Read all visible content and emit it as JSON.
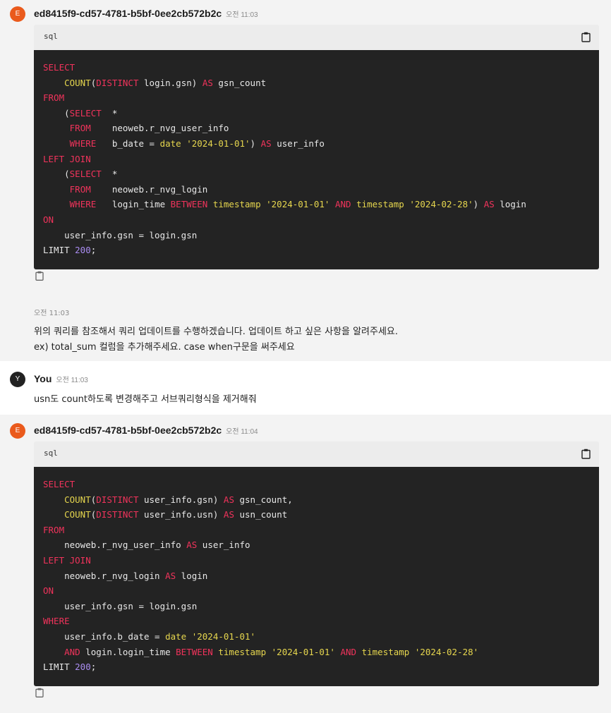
{
  "messages": [
    {
      "avatar_letter": "E",
      "sender": "ed8415f9-cd57-4781-b5bf-0ee2cb572b2c",
      "time": "오전 11:03",
      "code": {
        "language": "sql",
        "lines": [
          [
            {
              "t": "SELECT",
              "c": "kw"
            }
          ],
          [
            {
              "t": "    ",
              "c": "plain"
            },
            {
              "t": "COUNT",
              "c": "fn"
            },
            {
              "t": "(",
              "c": "plain"
            },
            {
              "t": "DISTINCT",
              "c": "kw"
            },
            {
              "t": " login.gsn) ",
              "c": "plain"
            },
            {
              "t": "AS",
              "c": "kw"
            },
            {
              "t": " gsn_count",
              "c": "plain"
            }
          ],
          [
            {
              "t": "FROM",
              "c": "kw"
            }
          ],
          [
            {
              "t": "    (",
              "c": "plain"
            },
            {
              "t": "SELECT",
              "c": "kw"
            },
            {
              "t": "  *",
              "c": "plain"
            }
          ],
          [
            {
              "t": "     ",
              "c": "plain"
            },
            {
              "t": "FROM",
              "c": "kw"
            },
            {
              "t": "    neoweb.r_nvg_user_info",
              "c": "plain"
            }
          ],
          [
            {
              "t": "     ",
              "c": "plain"
            },
            {
              "t": "WHERE",
              "c": "kw"
            },
            {
              "t": "   b_date = ",
              "c": "plain"
            },
            {
              "t": "date",
              "c": "fn"
            },
            {
              "t": " ",
              "c": "plain"
            },
            {
              "t": "'2024-01-01'",
              "c": "str"
            },
            {
              "t": ") ",
              "c": "plain"
            },
            {
              "t": "AS",
              "c": "kw"
            },
            {
              "t": " user_info",
              "c": "plain"
            }
          ],
          [
            {
              "t": "LEFT JOIN",
              "c": "kw"
            }
          ],
          [
            {
              "t": "    (",
              "c": "plain"
            },
            {
              "t": "SELECT",
              "c": "kw"
            },
            {
              "t": "  *",
              "c": "plain"
            }
          ],
          [
            {
              "t": "     ",
              "c": "plain"
            },
            {
              "t": "FROM",
              "c": "kw"
            },
            {
              "t": "    neoweb.r_nvg_login",
              "c": "plain"
            }
          ],
          [
            {
              "t": "     ",
              "c": "plain"
            },
            {
              "t": "WHERE",
              "c": "kw"
            },
            {
              "t": "   login_time ",
              "c": "plain"
            },
            {
              "t": "BETWEEN",
              "c": "kw"
            },
            {
              "t": " ",
              "c": "plain"
            },
            {
              "t": "timestamp",
              "c": "fn"
            },
            {
              "t": " ",
              "c": "plain"
            },
            {
              "t": "'2024-01-01'",
              "c": "str"
            },
            {
              "t": " ",
              "c": "plain"
            },
            {
              "t": "AND",
              "c": "kw"
            },
            {
              "t": " ",
              "c": "plain"
            },
            {
              "t": "timestamp",
              "c": "fn"
            },
            {
              "t": " ",
              "c": "plain"
            },
            {
              "t": "'2024-02-28'",
              "c": "str"
            },
            {
              "t": ") ",
              "c": "plain"
            },
            {
              "t": "AS",
              "c": "kw"
            },
            {
              "t": " login",
              "c": "plain"
            }
          ],
          [
            {
              "t": "ON",
              "c": "kw"
            }
          ],
          [
            {
              "t": "    user_info.gsn = login.gsn",
              "c": "plain"
            }
          ],
          [
            {
              "t": "LIMIT ",
              "c": "plain"
            },
            {
              "t": "200",
              "c": "num"
            },
            {
              "t": ";",
              "c": "plain"
            }
          ]
        ]
      },
      "footer_time": "오전 11:03",
      "text_lines": [
        "위의 쿼리를 참조해서 쿼리 업데이트를 수행하겠습니다. 업데이트 하고 싶은 사항을 알려주세요.",
        "ex) total_sum 컬럼을 추가해주세요. case when구문을 써주세요"
      ]
    },
    {
      "avatar_letter": "Y",
      "sender": "You",
      "time": "오전 11:03",
      "text": "usn도 count하도록 변경해주고 서브쿼리형식을 제거해줘"
    },
    {
      "avatar_letter": "E",
      "sender": "ed8415f9-cd57-4781-b5bf-0ee2cb572b2c",
      "time": "오전 11:04",
      "code": {
        "language": "sql",
        "lines": [
          [
            {
              "t": "SELECT",
              "c": "kw"
            }
          ],
          [
            {
              "t": "    ",
              "c": "plain"
            },
            {
              "t": "COUNT",
              "c": "fn"
            },
            {
              "t": "(",
              "c": "plain"
            },
            {
              "t": "DISTINCT",
              "c": "kw"
            },
            {
              "t": " user_info.gsn) ",
              "c": "plain"
            },
            {
              "t": "AS",
              "c": "kw"
            },
            {
              "t": " gsn_count,",
              "c": "plain"
            }
          ],
          [
            {
              "t": "    ",
              "c": "plain"
            },
            {
              "t": "COUNT",
              "c": "fn"
            },
            {
              "t": "(",
              "c": "plain"
            },
            {
              "t": "DISTINCT",
              "c": "kw"
            },
            {
              "t": " user_info.usn) ",
              "c": "plain"
            },
            {
              "t": "AS",
              "c": "kw"
            },
            {
              "t": " usn_count",
              "c": "plain"
            }
          ],
          [
            {
              "t": "FROM",
              "c": "kw"
            }
          ],
          [
            {
              "t": "    neoweb.r_nvg_user_info ",
              "c": "plain"
            },
            {
              "t": "AS",
              "c": "kw"
            },
            {
              "t": " user_info",
              "c": "plain"
            }
          ],
          [
            {
              "t": "LEFT JOIN",
              "c": "kw"
            }
          ],
          [
            {
              "t": "    neoweb.r_nvg_login ",
              "c": "plain"
            },
            {
              "t": "AS",
              "c": "kw"
            },
            {
              "t": " login",
              "c": "plain"
            }
          ],
          [
            {
              "t": "ON",
              "c": "kw"
            }
          ],
          [
            {
              "t": "    user_info.gsn = login.gsn",
              "c": "plain"
            }
          ],
          [
            {
              "t": "WHERE",
              "c": "kw"
            }
          ],
          [
            {
              "t": "    user_info.b_date = ",
              "c": "plain"
            },
            {
              "t": "date",
              "c": "fn"
            },
            {
              "t": " ",
              "c": "plain"
            },
            {
              "t": "'2024-01-01'",
              "c": "str"
            }
          ],
          [
            {
              "t": "    ",
              "c": "plain"
            },
            {
              "t": "AND",
              "c": "kw"
            },
            {
              "t": " login.login_time ",
              "c": "plain"
            },
            {
              "t": "BETWEEN",
              "c": "kw"
            },
            {
              "t": " ",
              "c": "plain"
            },
            {
              "t": "timestamp",
              "c": "fn"
            },
            {
              "t": " ",
              "c": "plain"
            },
            {
              "t": "'2024-01-01'",
              "c": "str"
            },
            {
              "t": " ",
              "c": "plain"
            },
            {
              "t": "AND",
              "c": "kw"
            },
            {
              "t": " ",
              "c": "plain"
            },
            {
              "t": "timestamp",
              "c": "fn"
            },
            {
              "t": " ",
              "c": "plain"
            },
            {
              "t": "'2024-02-28'",
              "c": "str"
            }
          ],
          [
            {
              "t": "LIMIT ",
              "c": "plain"
            },
            {
              "t": "200",
              "c": "num"
            },
            {
              "t": ";",
              "c": "plain"
            }
          ]
        ]
      }
    }
  ],
  "icons": {
    "copy_code": "clipboard-icon",
    "copy_message": "clipboard-icon"
  },
  "colors": {
    "bot_avatar": "#ea5a1c",
    "user_avatar": "#222222",
    "code_bg": "#232323",
    "keyword": "#f0335b",
    "function": "#e6d64e",
    "number": "#a98cf0"
  }
}
